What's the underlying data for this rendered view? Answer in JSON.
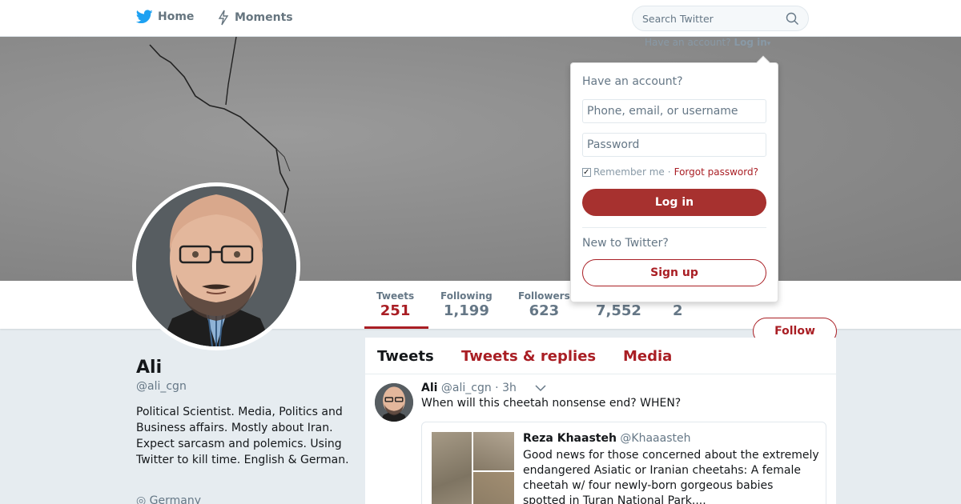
{
  "nav": {
    "home_label": "Home",
    "moments_label": "Moments",
    "search_placeholder": "Search Twitter"
  },
  "login_hint": {
    "prefix": "Have an account?",
    "login_label": "Log in"
  },
  "profile": {
    "name": "Ali",
    "handle": "@ali_cgn",
    "bio": "Political Scientist. Media, Politics and Business affairs. Mostly about Iran. Expect sarcasm and polemics. Using Twitter to kill time. English & German.",
    "location": "Germany",
    "follow_label": "Follow"
  },
  "stats": [
    {
      "label": "Tweets",
      "value": "251"
    },
    {
      "label": "Following",
      "value": "1,199"
    },
    {
      "label": "Followers",
      "value": "623"
    },
    {
      "label": "",
      "value": "7,552"
    },
    {
      "label": "",
      "value": "2"
    }
  ],
  "timeline": {
    "tabs": [
      "Tweets",
      "Tweets & replies",
      "Media"
    ],
    "active_tab": "Tweets"
  },
  "tweet": {
    "name": "Ali",
    "handle": "@ali_cgn",
    "time": "· 3h",
    "text": "When will this cheetah nonsense end? WHEN?",
    "quote": {
      "name": "Reza Khaasteh",
      "handle": "@Khaaasteh",
      "text": "Good news for those concerned about the extremely endangered Asiatic or Iranian cheetahs: A female cheetah w/ four newly-born gorgeous babies spotted in Turan National Park...."
    }
  },
  "login_dropdown": {
    "title": "Have an account?",
    "user_placeholder": "Phone, email, or username",
    "password_placeholder": "Password",
    "remember_label": "Remember me",
    "separator": "·",
    "forgot_label": "Forgot password?",
    "login_button": "Log in",
    "new_label": "New to Twitter?",
    "signup_button": "Sign up"
  },
  "colors": {
    "accent": "#a91e24",
    "login_button_bg": "#a7312f",
    "twitter_blue": "#1da1f2",
    "background": "#e6ecf0"
  }
}
